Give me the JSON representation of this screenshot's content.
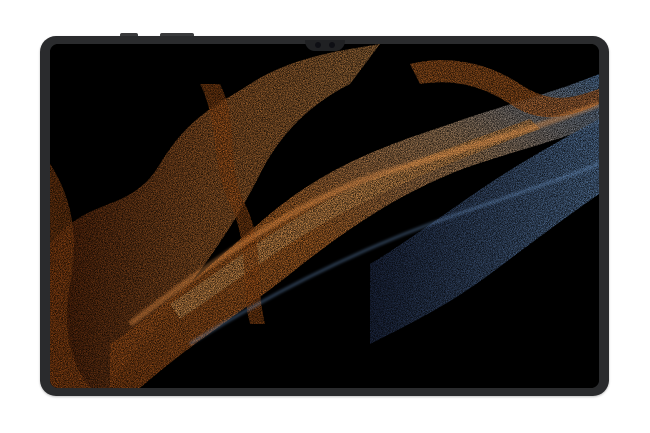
{
  "device": {
    "colors": {
      "frame": "#2a2b2d",
      "screen_bg": "#000000",
      "glow_orange": "#e07a2a",
      "glow_blue": "#6f9fd8"
    },
    "wallpaper_icon": "particle-wave-wallpaper"
  }
}
